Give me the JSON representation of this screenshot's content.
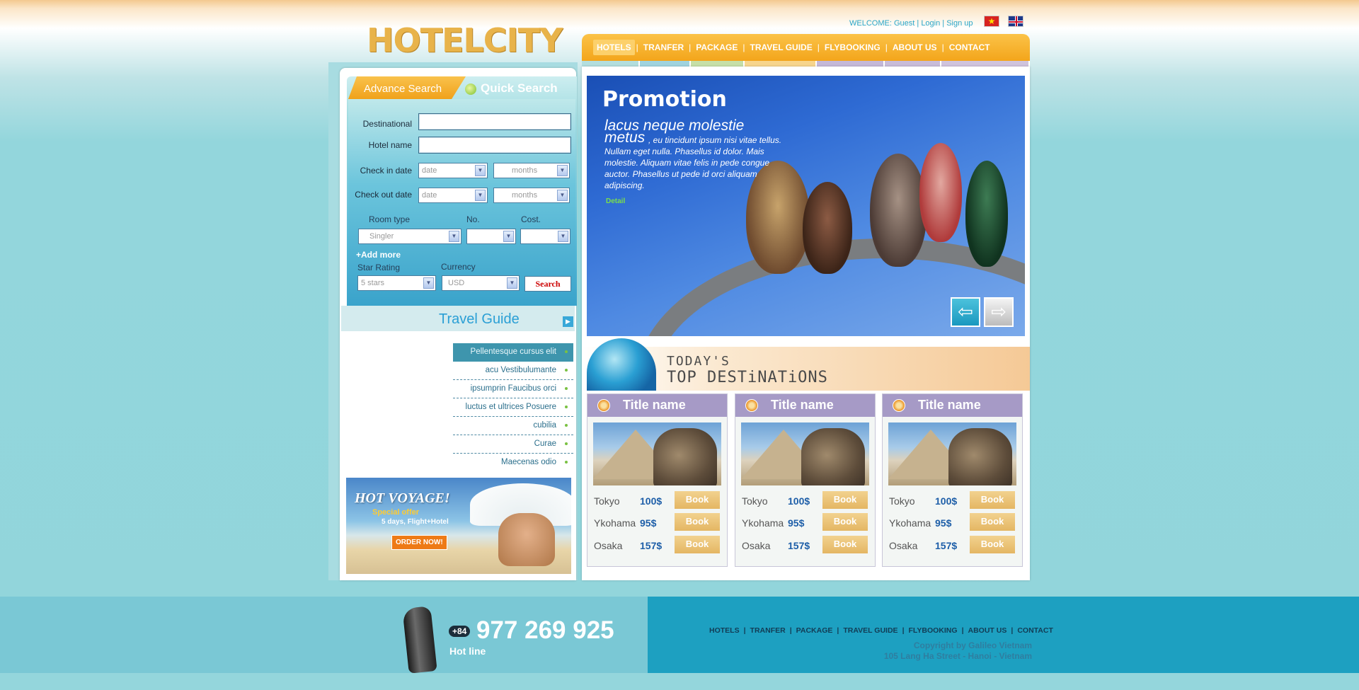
{
  "header": {
    "logo": "HOTELCITY",
    "welcome_prefix": "WELCOME:",
    "guest": "Guest",
    "login": "Login",
    "signup": "Sign up",
    "sep": "|"
  },
  "nav": {
    "items": [
      "HOTELS",
      "TRANFER",
      "PACKAGE",
      "TRAVEL GUIDE",
      "FLYBOOKING",
      "ABOUT US",
      "CONTACT"
    ],
    "stripe_colors": [
      "#b3dede",
      "#9fd3df",
      "#c6dfa8",
      "#f7d58d",
      "#c4b8d8",
      "#c8bcd9",
      "#cfc3dd"
    ]
  },
  "search": {
    "tab_advance": "Advance Search",
    "tab_quick": "Quick Search",
    "destination_label": "Destinational",
    "hotel_label": "Hotel name",
    "checkin_label": "Check in date",
    "checkout_label": "Check out date",
    "date_placeholder": "date",
    "months_placeholder": "months",
    "room_type_label": "Room type",
    "no_label": "No.",
    "cost_label": "Cost.",
    "room_type_value": "Singler",
    "add_more": "+Add more",
    "star_label": "Star Rating",
    "currency_label": "Currency",
    "star_value": "5 stars",
    "currency_value": "USD",
    "search_button": "Search"
  },
  "travel_guide": {
    "title": "Travel Guide",
    "items": [
      "Pellentesque cursus elit",
      "acu Vestibulumante",
      "ipsumprin Faucibus orci",
      "luctus et ultrices Posuere",
      "cubilia",
      "Curae",
      "Maecenas odio"
    ]
  },
  "hot_voyage": {
    "title": "HOT VOYAGE!",
    "special": "Special offer",
    "days": "5 days, Flight+Hotel",
    "order": "ORDER NOW!"
  },
  "promo": {
    "title": "Promotion",
    "subtitle": "lacus neque molestie metus",
    "text": ", eu tincidunt ipsum nisi vitae tellus. Nullam eget nulla. Phasellus id dolor. Mais molestie. Aliquam vitae felis in pede congue auctor. Phasellus ut pede id orci aliquam adipiscing.",
    "detail": "Detail"
  },
  "today": {
    "line1": "TODAY'S",
    "line2": "TOP DESTiNATiONS"
  },
  "cards": [
    {
      "title": "Title name",
      "rows": [
        {
          "city": "Tokyo",
          "price": "100$",
          "book": "Book"
        },
        {
          "city": "Ykohama",
          "price": "95$",
          "book": "Book"
        },
        {
          "city": "Osaka",
          "price": "157$",
          "book": "Book"
        }
      ]
    },
    {
      "title": "Title name",
      "rows": [
        {
          "city": "Tokyo",
          "price": "100$",
          "book": "Book"
        },
        {
          "city": "Ykohama",
          "price": "95$",
          "book": "Book"
        },
        {
          "city": "Osaka",
          "price": "157$",
          "book": "Book"
        }
      ]
    },
    {
      "title": "Title name",
      "rows": [
        {
          "city": "Tokyo",
          "price": "100$",
          "book": "Book"
        },
        {
          "city": "Ykohama",
          "price": "95$",
          "book": "Book"
        },
        {
          "city": "Osaka",
          "price": "157$",
          "book": "Book"
        }
      ]
    }
  ],
  "footer": {
    "country_code": "+84",
    "hotline_number": "977 269 925",
    "hotline_label": "Hot line",
    "nav": [
      "HOTELS",
      "TRANFER",
      "PACKAGE",
      "TRAVEL GUIDE",
      "FLYBOOKING",
      "ABOUT US",
      "CONTACT"
    ],
    "copyright": "Copyright by Galileo Vietnam",
    "address": "105 Lang Ha Street - Hanoi - Vietnam"
  }
}
